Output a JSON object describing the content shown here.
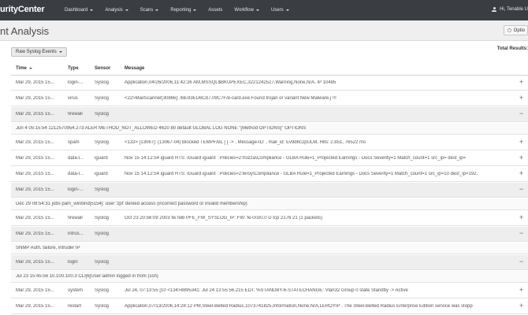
{
  "topnav": {
    "brand": "urityCenter",
    "items": [
      {
        "label": "Dashboard",
        "has_caret": true
      },
      {
        "label": "Analysis",
        "has_caret": true
      },
      {
        "label": "Scans",
        "has_caret": true
      },
      {
        "label": "Reporting",
        "has_caret": true
      },
      {
        "label": "Assets",
        "has_caret": false
      },
      {
        "label": "Workflow",
        "has_caret": true
      },
      {
        "label": "Users",
        "has_caret": true
      }
    ],
    "user_label": "Hi, Tenable U",
    "user_icon": "user-icon"
  },
  "page": {
    "title": "nt Analysis",
    "options_label": "Optio",
    "options_icon": "gear-icon"
  },
  "toolbar": {
    "view_label": "Raw Syslog Events",
    "total_label": "Total Results:"
  },
  "table": {
    "columns": {
      "time": "Time",
      "type": "Type",
      "sensor": "Sensor",
      "message": "Message"
    },
    "rows": [
      {
        "time": "Mar 29, 2015 15...",
        "type": "login-...",
        "sensor": "Syslog",
        "message": "Application,04/26/2006,11:42:26 AM,MSSQL$BKUPEXEC,3221242527,Warning,None,N/A,                       IP                   10485",
        "expanded": false,
        "detail": ""
      },
      {
        "time": "Mar 29, 2015 15...",
        "type": "virus",
        "sensor": "Syslog",
        "message": "<22>MailScanner[30866]: /BE93ED6C87.09C7F/e-card.exe Found trojan or variant New Malware.j !!!",
        "expanded": false,
        "detail": ""
      },
      {
        "time": "Mar 29, 2015 15...",
        "type": "firewall",
        "sensor": "Syslog",
        "message": "",
        "expanded": true,
        "detail": "Jun 4 05:15:54                    1212570954.273 ALER METHOD_NOT_ALLOWED                                4620                   80 default GLOBAL LOG NONE \"[Method OPTIONS]\" OPTIONS"
      },
      {
        "time": "Mar 29, 2015 15...",
        "type": "spam",
        "sensor": "Syslog",
        "message": "<133>              [13067]: (13067-04) Blocked TEMPFAIL                  [                                  ] -> , Message-ID: , mail_id: Ev9d6c2pULM, Hits: 2.851, 76522 ms",
        "expanded": false,
        "detail": ""
      },
      {
        "time": "Mar 29, 2015 15...",
        "type": "data-l...",
        "sensor": "iguard",
        "message": "Nov 15 14:12:54 iguard RTS: iGuard iguard : Policies=2:frozza\\Compliance - GLBA Rule=1_Projected Earnings - Docs Severity=1 Match_count=1 src_ip=                     dest_ip=",
        "expanded": false,
        "detail": ""
      },
      {
        "time": "Mar 29, 2015 15...",
        "type": "data-l...",
        "sensor": "iguard",
        "message": "Nov 15 14:12:54 iguard RTS: iGuard iguard : Policies=2:leroy\\Compliance - GLBA Rule=1_Projected Earnings - Docs Severity=1 Match_count=1 src_ip=10              dest_ip=192.",
        "expanded": false,
        "detail": ""
      },
      {
        "time": "Mar 29, 2015 15...",
        "type": "login-...",
        "sensor": "Syslog",
        "message": "",
        "expanded": true,
        "detail": "Dec 29 09:54:31 jobs pam_winbind[5154]: user 'zpt' denied access (incorrect password or invalid membership)"
      },
      {
        "time": "Mar 29, 2015 15...",
        "type": "firewall",
        "sensor": "Syslog",
        "message": "Oct 23 20:56:09 2003 fw fwb PFE_FW_SYSLOG_IP: FW: fe-0/3/0.0 D tcp                                          2176 21 (1 packets)",
        "expanded": false,
        "detail": ""
      },
      {
        "time": "Mar 29, 2015 15...",
        "type": "intrus...",
        "sensor": "Syslog",
        "message": "",
        "expanded": true,
        "detail": "SNMP Auth. failure, intruder IP"
      },
      {
        "time": "Mar 29, 2015 15...",
        "type": "login",
        "sensor": "Syslog",
        "message": "",
        "expanded": true,
        "detail": "Jul 23 15:45:56 10.100.100.3 CLI[6]User:admin logged in from                  (ssh)"
      },
      {
        "time": "Mar 29, 2015 15...",
        "type": "system",
        "sensor": "Syslog",
        "message": "Jul 24, 07:13:55 [10                   <134>8895341: Jul 24 13:55:56.215 EDT: %STANDBY-6-STATECHANGE: Vlan32 Group 0 state Standby -> Active",
        "expanded": false,
        "detail": ""
      },
      {
        "time": "Mar 29, 2015 15...",
        "type": "restart",
        "sensor": "Syslog",
        "message": "Application,07/13/2006,14:28:12 PM,Steel-Belted Radius,1073741825,Information,None,N/A,LEROYIP                    . The Steel-Belted Radius Enterprise Edition service was stopp",
        "expanded": false,
        "detail": ""
      }
    ]
  }
}
